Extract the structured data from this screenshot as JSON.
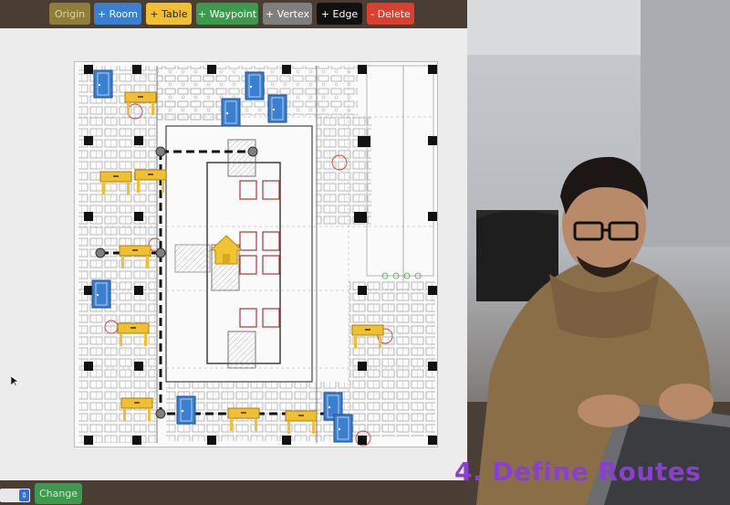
{
  "toolbar": {
    "origin": "Origin",
    "room": "+ Room",
    "table": "+ Table",
    "waypoint": "+ Waypoint",
    "vertex": "+ Vertex",
    "edge": "+ Edge",
    "delete": "- Delete"
  },
  "bottom": {
    "change": "Change"
  },
  "video": {
    "caption": "4. Define Routes"
  },
  "colors": {
    "toolbar_bg": "#4a3d33",
    "room": "#3a7fd0",
    "table": "#f0c030",
    "waypoint": "#3d9a4d",
    "vertex": "#7f7f7f",
    "edge": "#111111",
    "delete": "#d84030",
    "caption": "#8a3fd0"
  },
  "markers": {
    "home": "home-icon",
    "room": "door-icon",
    "table": "table-icon"
  }
}
